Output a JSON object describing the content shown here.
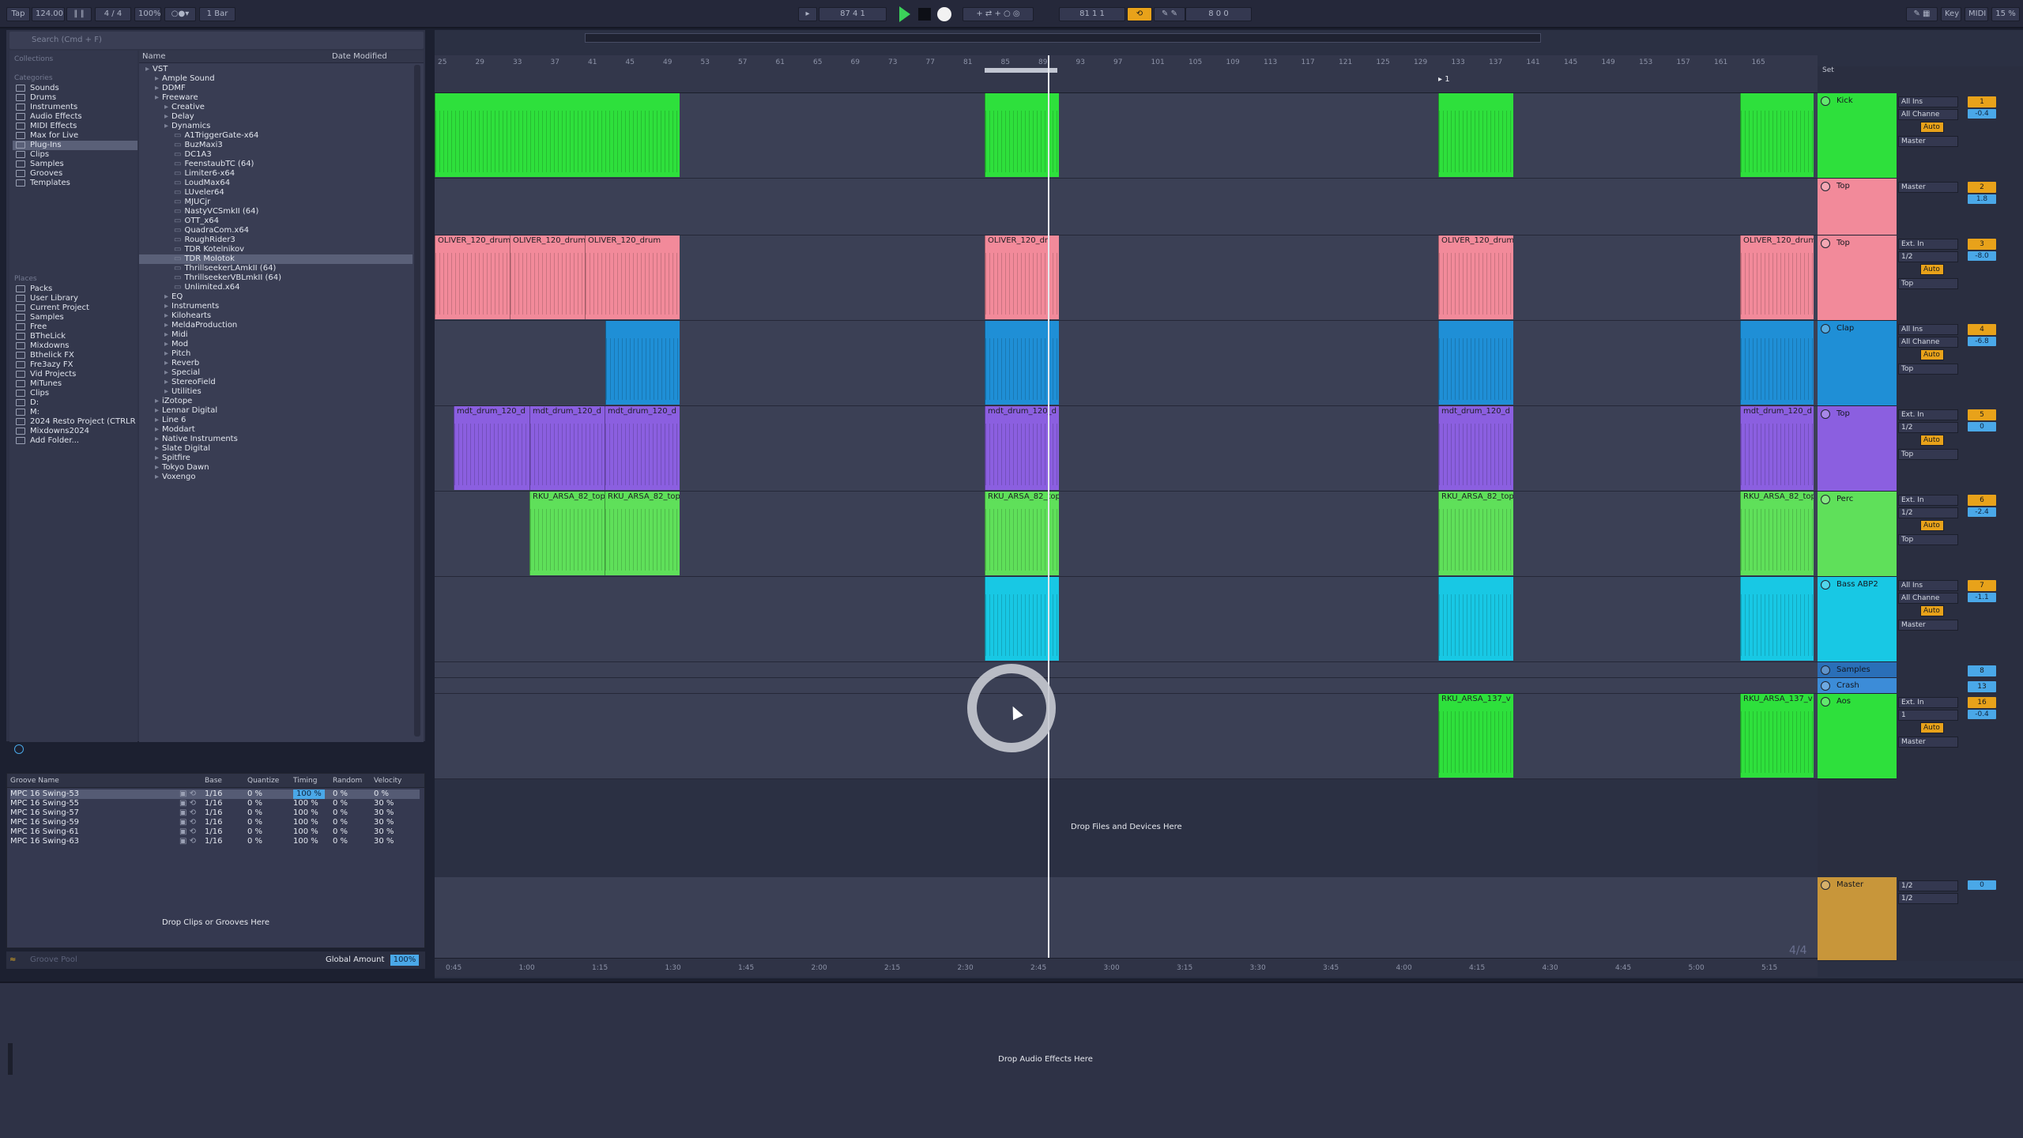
{
  "topbar": {
    "tap": "Tap",
    "tempo": "124.00",
    "signature": "4 / 4",
    "zoom": "100%",
    "quantize": "1 Bar",
    "arrangement_position": "87  4  1",
    "loop_start": "81  1  1",
    "loop_length": "8  0  0",
    "key": "Key",
    "midi": "MIDI",
    "cpu": "15 %"
  },
  "browser": {
    "search_placeholder": "Search (Cmd + F)",
    "collections_label": "Collections",
    "categories_label": "Categories",
    "places_label": "Places",
    "column_name": "Name",
    "column_modified": "Date Modified",
    "categories": [
      "Sounds",
      "Drums",
      "Instruments",
      "Audio Effects",
      "MIDI Effects",
      "Max for Live",
      "Plug-Ins",
      "Clips",
      "Samples",
      "Grooves",
      "Templates"
    ],
    "places": [
      "Packs",
      "User Library",
      "Current Project",
      "Samples",
      "Free",
      "BTheLick",
      "Mixdowns",
      "Bthelick FX",
      "Fre3azy FX",
      "Vid Projects",
      "MiTunes",
      "Clips",
      "D:",
      "M:",
      "2024 Resto Project (CTRLR",
      "Mixdowns2024",
      "Add Folder..."
    ],
    "tree": [
      {
        "label": "VST",
        "level": 0
      },
      {
        "label": "Ample Sound",
        "level": 1
      },
      {
        "label": "DDMF",
        "level": 1
      },
      {
        "label": "Freeware",
        "level": 1
      },
      {
        "label": "Creative",
        "level": 2
      },
      {
        "label": "Delay",
        "level": 2
      },
      {
        "label": "Dynamics",
        "level": 2
      },
      {
        "label": "A1TriggerGate-x64",
        "level": 3
      },
      {
        "label": "BuzMaxi3",
        "level": 3
      },
      {
        "label": "DC1A3",
        "level": 3
      },
      {
        "label": "FeenstaubTC (64)",
        "level": 3
      },
      {
        "label": "Limiter6-x64",
        "level": 3
      },
      {
        "label": "LoudMax64",
        "level": 3
      },
      {
        "label": "LUveler64",
        "level": 3
      },
      {
        "label": "MJUCjr",
        "level": 3
      },
      {
        "label": "NastyVCSmkII (64)",
        "level": 3
      },
      {
        "label": "OTT_x64",
        "level": 3
      },
      {
        "label": "QuadraCom.x64",
        "level": 3
      },
      {
        "label": "RoughRider3",
        "level": 3
      },
      {
        "label": "TDR Kotelnikov",
        "level": 3
      },
      {
        "label": "TDR Molotok",
        "level": 3
      },
      {
        "label": "ThrillseekerLAmkII (64)",
        "level": 3
      },
      {
        "label": "ThrillseekerVBLmkII (64)",
        "level": 3
      },
      {
        "label": "Unlimited.x64",
        "level": 3
      },
      {
        "label": "EQ",
        "level": 2
      },
      {
        "label": "Instruments",
        "level": 2
      },
      {
        "label": "Kilohearts",
        "level": 2
      },
      {
        "label": "MeldaProduction",
        "level": 2
      },
      {
        "label": "Midi",
        "level": 2
      },
      {
        "label": "Mod",
        "level": 2
      },
      {
        "label": "Pitch",
        "level": 2
      },
      {
        "label": "Reverb",
        "level": 2
      },
      {
        "label": "Special",
        "level": 2
      },
      {
        "label": "StereoField",
        "level": 2
      },
      {
        "label": "Utilities",
        "level": 2
      },
      {
        "label": "iZotope",
        "level": 1
      },
      {
        "label": "Lennar Digital",
        "level": 1
      },
      {
        "label": "Line 6",
        "level": 1
      },
      {
        "label": "Moddart",
        "level": 1
      },
      {
        "label": "Native Instruments",
        "level": 1
      },
      {
        "label": "Slate Digital",
        "level": 1
      },
      {
        "label": "Spitfire",
        "level": 1
      },
      {
        "label": "Tokyo Dawn",
        "level": 1
      },
      {
        "label": "Voxengo",
        "level": 1
      }
    ]
  },
  "groove": {
    "headers": [
      "Groove Name",
      "Base",
      "Quantize",
      "Timing",
      "Random",
      "Velocity"
    ],
    "rows": [
      [
        "MPC 16 Swing-53",
        "1/16",
        "0 %",
        "100 %",
        "0 %",
        "0 %"
      ],
      [
        "MPC 16 Swing-55",
        "1/16",
        "0 %",
        "100 %",
        "0 %",
        "30 %"
      ],
      [
        "MPC 16 Swing-57",
        "1/16",
        "0 %",
        "100 %",
        "0 %",
        "30 %"
      ],
      [
        "MPC 16 Swing-59",
        "1/16",
        "0 %",
        "100 %",
        "0 %",
        "30 %"
      ],
      [
        "MPC 16 Swing-61",
        "1/16",
        "0 %",
        "100 %",
        "0 %",
        "30 %"
      ],
      [
        "MPC 16 Swing-63",
        "1/16",
        "0 %",
        "100 %",
        "0 %",
        "30 %"
      ]
    ],
    "drop_text": "Drop Clips or Grooves Here",
    "global_amount_label": "Global Amount",
    "global_amount": "100%",
    "groove_pool_label": "Groove Pool"
  },
  "ruler": {
    "bars": [
      "25",
      "29",
      "33",
      "37",
      "41",
      "45",
      "49",
      "53",
      "57",
      "61",
      "65",
      "69",
      "73",
      "77",
      "81",
      "85",
      "89",
      "93",
      "97",
      "101",
      "105",
      "109",
      "113",
      "117",
      "121",
      "125",
      "129",
      "133",
      "137",
      "141",
      "145",
      "149",
      "153",
      "157",
      "161",
      "165"
    ],
    "locator": "1",
    "times": [
      "0:45",
      "1:00",
      "1:15",
      "1:30",
      "1:45",
      "2:00",
      "2:15",
      "2:30",
      "2:45",
      "3:00",
      "3:15",
      "3:30",
      "3:45",
      "4:00",
      "4:15",
      "4:30",
      "4:45",
      "5:00",
      "5:15"
    ],
    "set_label": "Set"
  },
  "tracks": [
    {
      "name": "Kick",
      "color": "#2ee03c",
      "input": "All Ins",
      "channel": "All Channe",
      "mon": "Auto",
      "out": "Master",
      "num": "1",
      "vol": "-0.4",
      "clips": []
    },
    {
      "name": "Top",
      "color": "#f28a9a",
      "input": "",
      "channel": "",
      "mon": "",
      "out": "Master",
      "num": "2",
      "vol": "1.8",
      "clips": []
    },
    {
      "name": "Top",
      "color": "#f28a9a",
      "input": "Ext. In",
      "channel": "1/2",
      "mon": "Auto",
      "out": "Top",
      "num": "3",
      "vol": "-8.0",
      "clips": [
        "OLIVER_120_drum",
        "OLIVER_120_drum",
        "OLIVER_120_drum",
        "OLIVER_120_dr",
        "OLIVER_120_drum",
        "OLIVER_120_drum"
      ]
    },
    {
      "name": "Clap",
      "color": "#1f8fd6",
      "input": "All Ins",
      "channel": "All Channe",
      "mon": "Auto",
      "out": "Top",
      "num": "4",
      "vol": "-6.8",
      "clips": []
    },
    {
      "name": "Top",
      "color": "#8b5fe0",
      "input": "Ext. In",
      "channel": "1/2",
      "mon": "Auto",
      "out": "Top",
      "num": "5",
      "vol": "0",
      "clips": [
        "mdt_drum_120_d",
        "mdt_drum_120_d",
        "mdt_drum_120_d",
        "mdt_drum_120_d",
        "mdt_drum_120_d",
        "mdt_drum_120_d"
      ]
    },
    {
      "name": "Perc",
      "color": "#5fe05a",
      "input": "Ext. In",
      "channel": "1/2",
      "mon": "Auto",
      "out": "Top",
      "num": "6",
      "vol": "-2.4",
      "clips": [
        "RKU_ARSA_82_top",
        "RKU_ARSA_82_top",
        "RKU_ARSA_82_top",
        "RKU_ARSA_82_top",
        "RKU_ARSA_82_top"
      ]
    },
    {
      "name": "Bass ABP2",
      "color": "#18c8e4",
      "input": "All Ins",
      "channel": "All Channe",
      "mon": "Auto",
      "out": "Master",
      "num": "7",
      "vol": "-1.1",
      "clips": []
    },
    {
      "name": "Samples",
      "color": "#2a6fb8",
      "num": "8"
    },
    {
      "name": "Crash",
      "color": "#3c8cd8",
      "num": "13"
    },
    {
      "name": "Aos",
      "color": "#2ee03c",
      "input": "Ext. In",
      "channel": "1",
      "mon": "Auto",
      "out": "Master",
      "num": "16",
      "vol": "-0.4",
      "clips": [
        "RKU_ARSA_137_v",
        "RKU_ARSA_137_v"
      ]
    },
    {
      "name": "Master",
      "color": "#c8963a",
      "out1": "1/2",
      "out2": "1/2",
      "vol": "0"
    }
  ],
  "arrangement": {
    "drop_files": "Drop Files and Devices Here",
    "signature_display": "4/4"
  },
  "detail": {
    "drop_effects": "Drop Audio Effects Here"
  }
}
